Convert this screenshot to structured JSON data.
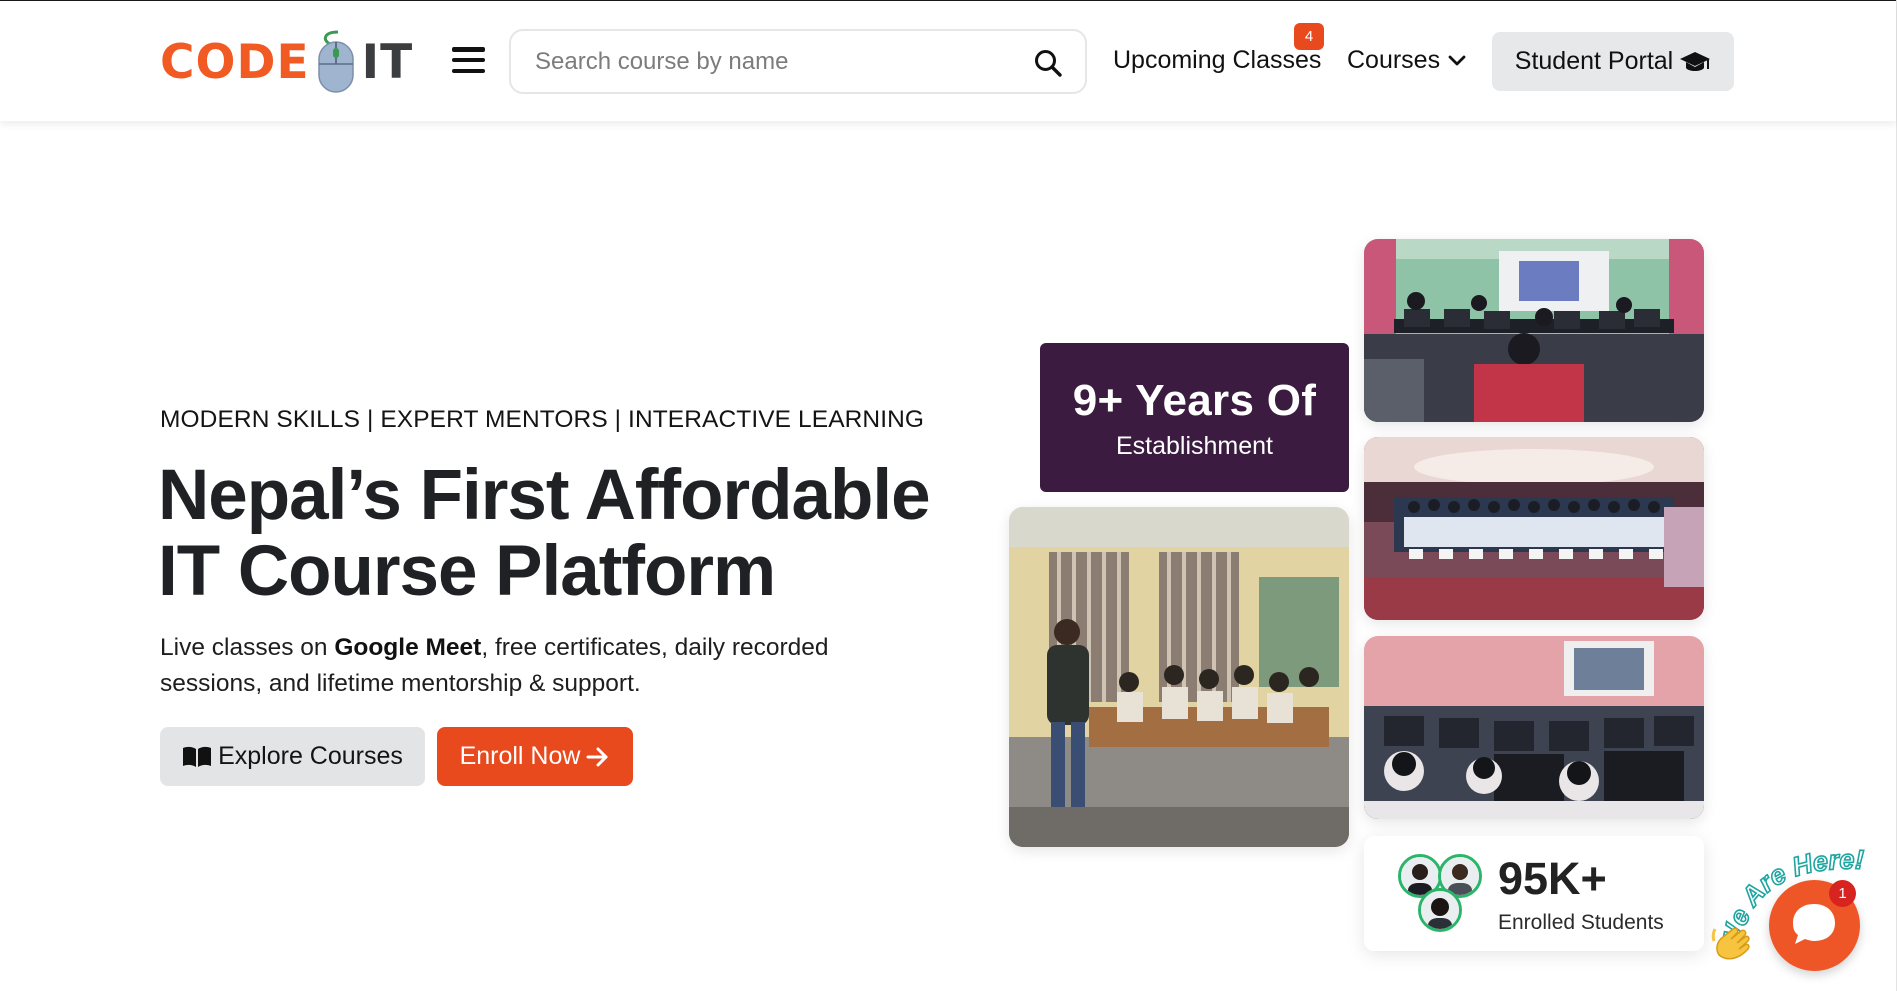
{
  "brand": {
    "logo_word1": "CODE",
    "logo_word2": "IT",
    "accent_color": "#e8491d",
    "dark_purple": "#3b1c40"
  },
  "nav": {
    "menu_icon": "hamburger-menu-icon",
    "search_placeholder": "Search course by name",
    "search_icon": "search-icon",
    "upcoming_label": "Upcoming Classes",
    "upcoming_badge": "4",
    "courses_label": "Courses",
    "courses_icon": "chevron-down-icon",
    "portal_label": "Student Portal",
    "portal_icon": "graduation-cap-icon"
  },
  "hero": {
    "tagline": "MODERN SKILLS | EXPERT MENTORS | INTERACTIVE LEARNING",
    "headline_line1": "Nepal’s First Affordable",
    "headline_line2": "IT Course Platform",
    "desc_part1": "Live classes on ",
    "desc_bold": "Google Meet",
    "desc_part2": ", free certificates, daily recorded sessions, and lifetime mentorship & support.",
    "explore_label": "Explore Courses",
    "explore_icon": "book-open-icon",
    "enroll_label": "Enroll Now",
    "enroll_icon": "arrow-right-icon"
  },
  "stats": {
    "years_title": "9+ Years Of",
    "years_sub": "Establishment",
    "students_count": "95K+",
    "students_label": "Enrolled Students"
  },
  "chat": {
    "greeting": "We Are Here!",
    "unread": "1",
    "wave_icon": "waving-hand-icon",
    "chat_icon": "chat-bubble-icon"
  }
}
